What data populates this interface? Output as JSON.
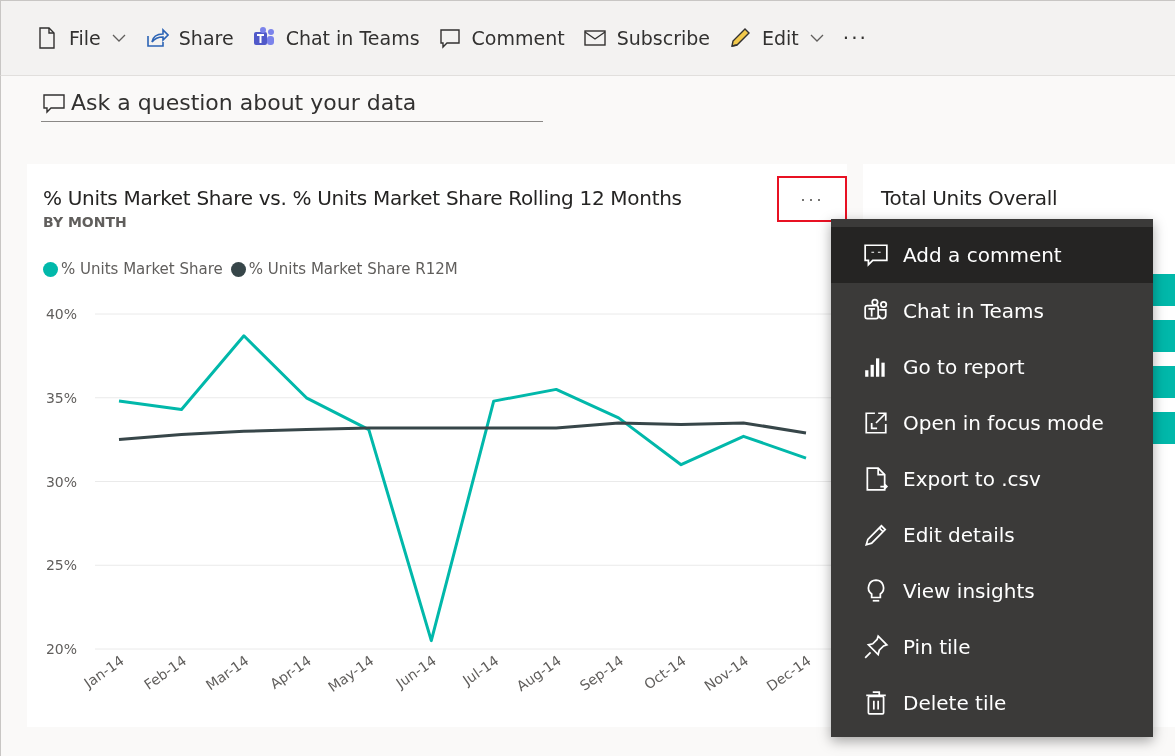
{
  "toolbar": {
    "items": [
      {
        "label": "File",
        "dropdown": true
      },
      {
        "label": "Share",
        "dropdown": false
      },
      {
        "label": "Chat in Teams",
        "dropdown": false
      },
      {
        "label": "Comment",
        "dropdown": false
      },
      {
        "label": "Subscribe",
        "dropdown": false
      },
      {
        "label": "Edit",
        "dropdown": true
      }
    ],
    "more": "···"
  },
  "qna": {
    "placeholder": "Ask a question about your data"
  },
  "tile": {
    "title": "% Units Market Share vs. % Units Market Share Rolling 12 Months",
    "subtitle": "BY MONTH",
    "more": "···",
    "highlighted": true,
    "chart_data": {
      "type": "line",
      "categories": [
        "Jan-14",
        "Feb-14",
        "Mar-14",
        "Apr-14",
        "May-14",
        "Jun-14",
        "Jul-14",
        "Aug-14",
        "Sep-14",
        "Oct-14",
        "Nov-14",
        "Dec-14"
      ],
      "grid": true,
      "ylim": [
        20,
        40
      ],
      "yticks": [
        {
          "value": 20,
          "label": "20%"
        },
        {
          "value": 25,
          "label": "25%"
        },
        {
          "value": 30,
          "label": "30%"
        },
        {
          "value": 35,
          "label": "35%"
        },
        {
          "value": 40,
          "label": "40%"
        }
      ],
      "series": [
        {
          "name": "% Units Market Share",
          "color": "#01b8aa",
          "values": [
            34.8,
            34.3,
            38.7,
            35.0,
            33.1,
            20.5,
            34.8,
            35.5,
            33.8,
            31.0,
            32.7,
            31.4
          ]
        },
        {
          "name": "% Units Market Share R12M",
          "color": "#374649",
          "values": [
            32.5,
            32.8,
            33.0,
            33.1,
            33.2,
            33.2,
            33.2,
            33.2,
            33.5,
            33.4,
            33.5,
            32.9
          ]
        }
      ]
    }
  },
  "tile2": {
    "title": "Total Units Overall"
  },
  "menu": {
    "items": [
      {
        "label": "Add a comment",
        "selected": true
      },
      {
        "label": "Chat in Teams",
        "selected": false
      },
      {
        "label": "Go to report",
        "selected": false
      },
      {
        "label": "Open in focus mode",
        "selected": false
      },
      {
        "label": "Export to .csv",
        "selected": false
      },
      {
        "label": "Edit details",
        "selected": false
      },
      {
        "label": "View insights",
        "selected": false
      },
      {
        "label": "Pin tile",
        "selected": false
      },
      {
        "label": "Delete tile",
        "selected": false
      }
    ]
  }
}
